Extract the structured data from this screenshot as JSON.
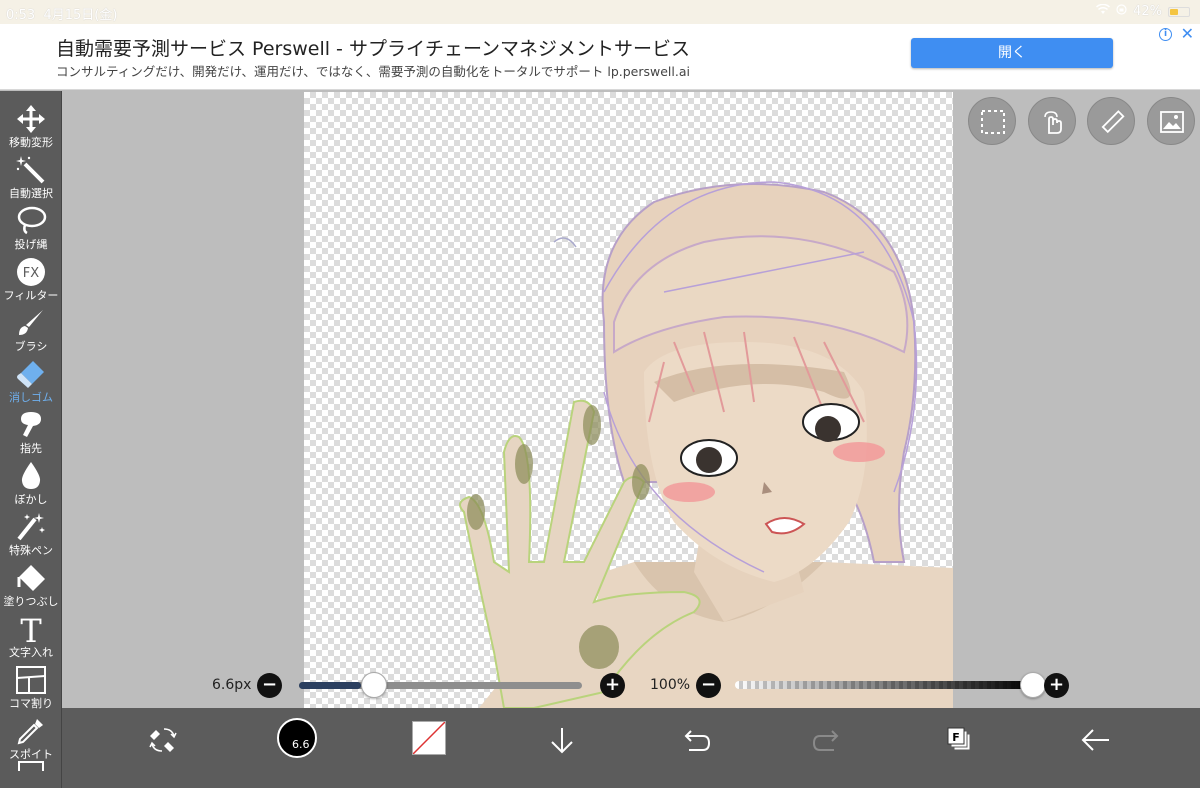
{
  "status_bar": {
    "time": "0:53",
    "date": "4月15日(金)",
    "battery": "42%",
    "battery_level": 0.42
  },
  "ad": {
    "title": "自動需要予測サービス Perswell - サプライチェーンマネジメントサービス",
    "description": "コンサルティングだけ、開発だけ、運用だけ、ではなく、需要予測の自動化をトータルでサポート lp.perswell.ai",
    "open_button": "開く",
    "info_icon_text": "i",
    "close_text": "✕"
  },
  "tools": [
    {
      "label": "移動変形",
      "icon": "move-icon"
    },
    {
      "label": "自動選択",
      "icon": "magic-wand-icon"
    },
    {
      "label": "投げ縄",
      "icon": "lasso-icon"
    },
    {
      "label": "フィルター",
      "icon": "fx-icon",
      "icon_text": "FX"
    },
    {
      "label": "ブラシ",
      "icon": "brush-icon"
    },
    {
      "label": "消しゴム",
      "icon": "eraser-icon",
      "active": true
    },
    {
      "label": "指先",
      "icon": "finger-icon"
    },
    {
      "label": "ぼかし",
      "icon": "blur-drop-icon"
    },
    {
      "label": "特殊ペン",
      "icon": "special-pen-icon"
    },
    {
      "label": "塗りつぶし",
      "icon": "fill-bucket-icon"
    },
    {
      "label": "文字入れ",
      "icon": "text-icon",
      "icon_text": "T"
    },
    {
      "label": "コマ割り",
      "icon": "panel-split-icon"
    },
    {
      "label": "スポイト",
      "icon": "eyedropper-icon"
    }
  ],
  "size_slider": {
    "value_label": "6.6px",
    "minus": "−",
    "plus": "+",
    "fraction": 0.22
  },
  "opacity_slider": {
    "value_label": "100%",
    "minus": "−",
    "plus": "+",
    "fraction": 1.0
  },
  "bottom_bar": {
    "brush_size_value": "6.6",
    "layer_label": "F"
  },
  "colors": {
    "accent": "#3f8ef2",
    "active_tool": "#6fb0ee",
    "toolbar_bg": "#5b5b5b"
  }
}
